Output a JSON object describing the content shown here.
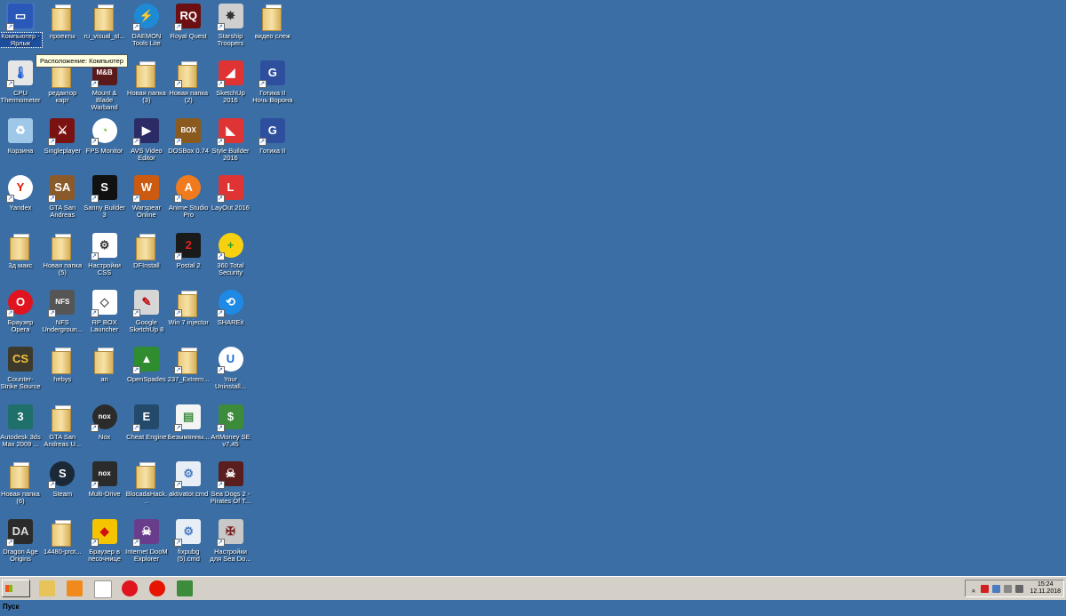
{
  "desktop": {
    "background_color": "#3a6ea5",
    "tooltip": "Расположение: Компьютер",
    "selected_icon": "Компьютер - Ярлык",
    "icons": [
      {
        "label": "Компьютер - Ярлык",
        "icon": "computer-icon",
        "column": 0,
        "row": 0
      },
      {
        "label": "CPU Thermometer",
        "icon": "thermometer-icon",
        "column": 0,
        "row": 1
      },
      {
        "label": "Корзина",
        "icon": "recycle-bin-icon",
        "column": 0,
        "row": 2
      },
      {
        "label": "Yandex",
        "icon": "yandex-icon",
        "column": 0,
        "row": 3
      },
      {
        "label": "3д макс",
        "icon": "folder-icon",
        "column": 0,
        "row": 4
      },
      {
        "label": "Браузер Opera",
        "icon": "opera-icon",
        "column": 0,
        "row": 5
      },
      {
        "label": "Counter-Strike Source",
        "icon": "counter-strike-icon",
        "column": 0,
        "row": 6
      },
      {
        "label": "Autodesk 3ds Max 2009 ...",
        "icon": "3ds-max-icon",
        "column": 0,
        "row": 7
      },
      {
        "label": "Новая папка (6)",
        "icon": "folder-icon",
        "column": 0,
        "row": 8
      },
      {
        "label": "Dragon Age Origins",
        "icon": "dragon-age-icon",
        "column": 0,
        "row": 9
      },
      {
        "label": "проекты",
        "icon": "folder-icon",
        "column": 1,
        "row": 0
      },
      {
        "label": "редактор карт",
        "icon": "folder-icon",
        "column": 1,
        "row": 1
      },
      {
        "label": "Singleplayer",
        "icon": "game-icon",
        "column": 1,
        "row": 2
      },
      {
        "label": "GTA San Andreas",
        "icon": "gta-icon",
        "column": 1,
        "row": 3
      },
      {
        "label": "Новая папка (5)",
        "icon": "folder-icon",
        "column": 1,
        "row": 4
      },
      {
        "label": "NFS Undergroun...",
        "icon": "nfs-icon",
        "column": 1,
        "row": 5
      },
      {
        "label": "hebys",
        "icon": "folder-icon",
        "column": 1,
        "row": 6
      },
      {
        "label": "GTA San Andreas U...",
        "icon": "folder-icon",
        "column": 1,
        "row": 7
      },
      {
        "label": "Steam",
        "icon": "steam-icon",
        "column": 1,
        "row": 8
      },
      {
        "label": "14480-prot...",
        "icon": "folder-icon",
        "column": 1,
        "row": 9
      },
      {
        "label": "ru_visual_st...",
        "icon": "folder-icon",
        "column": 2,
        "row": 0
      },
      {
        "label": "Mount & Blade Warband",
        "icon": "mount-blade-icon",
        "column": 2,
        "row": 1
      },
      {
        "label": "FPS Monitor",
        "icon": "fps-monitor-icon",
        "column": 2,
        "row": 2
      },
      {
        "label": "Sanny Builder 3",
        "icon": "sanny-builder-icon",
        "column": 2,
        "row": 3
      },
      {
        "label": "Настройки CSS",
        "icon": "steam-settings-icon",
        "column": 2,
        "row": 4
      },
      {
        "label": "RP BOX Launcher",
        "icon": "rpbox-icon",
        "column": 2,
        "row": 5
      },
      {
        "label": "an",
        "icon": "folder-icon",
        "column": 2,
        "row": 6
      },
      {
        "label": "Nox",
        "icon": "nox-icon",
        "column": 2,
        "row": 7
      },
      {
        "label": "Multi-Drive",
        "icon": "nox-multi-icon",
        "column": 2,
        "row": 8
      },
      {
        "label": "Браузер в песочнице",
        "icon": "sandbox-browser-icon",
        "column": 2,
        "row": 9
      },
      {
        "label": "DAEMON Tools Lite",
        "icon": "daemon-tools-icon",
        "column": 3,
        "row": 0
      },
      {
        "label": "Новая папка (3)",
        "icon": "folder-icon",
        "column": 3,
        "row": 1
      },
      {
        "label": "AVS Video Editor",
        "icon": "avs-video-icon",
        "column": 3,
        "row": 2
      },
      {
        "label": "Warspear Online",
        "icon": "warspear-icon",
        "column": 3,
        "row": 3
      },
      {
        "label": "DFInstall",
        "icon": "folder-icon",
        "column": 3,
        "row": 4
      },
      {
        "label": "Google SketchUp 8",
        "icon": "sketchup-icon",
        "column": 3,
        "row": 5
      },
      {
        "label": "OpenSpades",
        "icon": "openspades-icon",
        "column": 3,
        "row": 6
      },
      {
        "label": "Cheat Engine",
        "icon": "cheat-engine-icon",
        "column": 3,
        "row": 7
      },
      {
        "label": "BlocadaHack...",
        "icon": "folder-icon",
        "column": 3,
        "row": 8
      },
      {
        "label": "Internet DooM Explorer",
        "icon": "doom-explorer-icon",
        "column": 3,
        "row": 9
      },
      {
        "label": "Royal Quest",
        "icon": "royal-quest-icon",
        "column": 4,
        "row": 0
      },
      {
        "label": "Новая папка (2)",
        "icon": "folder-icon",
        "column": 4,
        "row": 1
      },
      {
        "label": "DOSBox 0.74",
        "icon": "dosbox-icon",
        "column": 4,
        "row": 2
      },
      {
        "label": "Anime Studio Pro",
        "icon": "anime-studio-icon",
        "column": 4,
        "row": 3
      },
      {
        "label": "Postal 2",
        "icon": "postal-icon",
        "column": 4,
        "row": 4
      },
      {
        "label": "Win 7 injector",
        "icon": "folder-icon",
        "column": 4,
        "row": 5
      },
      {
        "label": "237_Extrem...",
        "icon": "folder-icon",
        "column": 4,
        "row": 6
      },
      {
        "label": "Безымянны...",
        "icon": "document-icon",
        "column": 4,
        "row": 7
      },
      {
        "label": "aktivator.cmd",
        "icon": "cmd-script-icon",
        "column": 4,
        "row": 8
      },
      {
        "label": "fixpubg (5).cmd",
        "icon": "cmd-script-icon",
        "column": 4,
        "row": 9
      },
      {
        "label": "Starship Troopers",
        "icon": "starship-troopers-icon",
        "column": 5,
        "row": 0
      },
      {
        "label": "SketchUp 2016",
        "icon": "sketchup-2016-icon",
        "column": 5,
        "row": 1
      },
      {
        "label": "Style Builder 2016",
        "icon": "style-builder-icon",
        "column": 5,
        "row": 2
      },
      {
        "label": "LayOut 2016",
        "icon": "layout-icon",
        "column": 5,
        "row": 3
      },
      {
        "label": "360 Total Security",
        "icon": "360-security-icon",
        "column": 5,
        "row": 4
      },
      {
        "label": "SHAREit",
        "icon": "shareit-icon",
        "column": 5,
        "row": 5
      },
      {
        "label": "Your Uninstall...",
        "icon": "uninstaller-icon",
        "column": 5,
        "row": 6
      },
      {
        "label": "ArtMoney SE v7.45",
        "icon": "artmoney-icon",
        "column": 5,
        "row": 7
      },
      {
        "label": "Sea Dogs 2 - Pirates Of T...",
        "icon": "sea-dogs-icon",
        "column": 5,
        "row": 8
      },
      {
        "label": "Настройки для Sea Do...",
        "icon": "sea-dogs-settings-icon",
        "column": 5,
        "row": 9
      },
      {
        "label": "видео слеж",
        "icon": "folder-icon",
        "column": 6,
        "row": 0
      },
      {
        "label": "Готика II Ночь Ворона",
        "icon": "gothic-icon",
        "column": 6,
        "row": 1
      },
      {
        "label": "Готика II",
        "icon": "gothic-icon",
        "column": 6,
        "row": 2
      }
    ]
  },
  "taskbar": {
    "start_label": "Пуск",
    "quick_launch": [
      {
        "name": "explorer-icon",
        "color": "#e8c35a"
      },
      {
        "name": "media-player-icon",
        "color": "#f08a1c"
      },
      {
        "name": "notepad-icon",
        "color": "#ffffff"
      },
      {
        "name": "opera-icon",
        "color": "#e0141e"
      },
      {
        "name": "yandex-icon",
        "color": "#e61400"
      },
      {
        "name": "artmoney-icon",
        "color": "#3c8c3c"
      }
    ],
    "tray_icons": [
      "expand-arrow-icon",
      "antivirus-icon",
      "network-icon",
      "action-center-icon",
      "volume-icon"
    ],
    "clock": {
      "time": "15:24",
      "date": "12.11.2018"
    }
  }
}
